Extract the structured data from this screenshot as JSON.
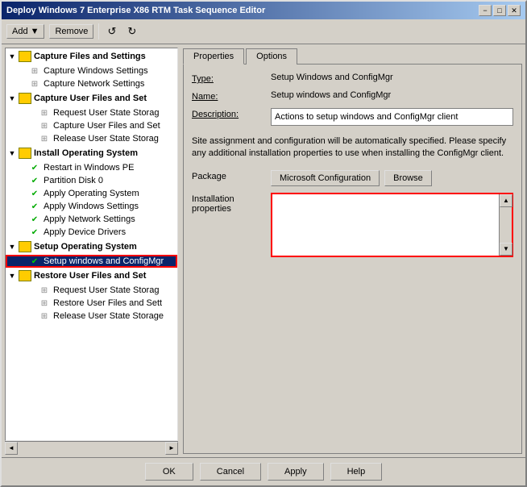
{
  "window": {
    "title": "Deploy Windows 7 Enterprise X86 RTM Task Sequence Editor",
    "min_btn": "−",
    "max_btn": "□",
    "close_btn": "✕"
  },
  "toolbar": {
    "add_label": "Add",
    "remove_label": "Remove",
    "icon1": "↺",
    "icon2": "↻"
  },
  "tree": {
    "groups": [
      {
        "label": "Capture Files and Settings",
        "items": [
          {
            "label": "Capture Windows Settings",
            "icon": "gray"
          },
          {
            "label": "Capture Network Settings",
            "icon": "gray"
          },
          {
            "label": "Capture User Files and Set",
            "icon": "gray",
            "indent": 2
          },
          {
            "label": "Request User State Storag",
            "icon": "gray",
            "indent": 3
          },
          {
            "label": "Capture User Files and Set",
            "icon": "gray",
            "indent": 3
          },
          {
            "label": "Release User State Storag",
            "icon": "gray",
            "indent": 3
          }
        ]
      },
      {
        "label": "Install Operating System",
        "items": [
          {
            "label": "Restart in Windows PE",
            "icon": "green"
          },
          {
            "label": "Partition Disk 0",
            "icon": "green"
          },
          {
            "label": "Apply Operating System",
            "icon": "green"
          },
          {
            "label": "Apply Windows Settings",
            "icon": "green"
          },
          {
            "label": "Apply Network Settings",
            "icon": "green"
          },
          {
            "label": "Apply Device Drivers",
            "icon": "green"
          }
        ]
      },
      {
        "label": "Setup Operating System",
        "items": [
          {
            "label": "Setup windows and ConfigMgr",
            "icon": "green",
            "selected": true
          },
          {
            "label": "Restore User Files and Set",
            "icon": "gray",
            "indent": 2
          },
          {
            "label": "Request User State Storag",
            "icon": "gray",
            "indent": 3
          },
          {
            "label": "Restore User Files and Sett",
            "icon": "gray",
            "indent": 3
          },
          {
            "label": "Release User State Storage",
            "icon": "gray",
            "indent": 3
          }
        ]
      }
    ]
  },
  "tabs": {
    "properties_label": "Properties",
    "options_label": "Options"
  },
  "properties": {
    "type_label": "Type:",
    "type_value": "Setup Windows and ConfigMgr",
    "name_label": "Name:",
    "name_value": "Setup windows and ConfigMgr",
    "description_label": "Description:",
    "description_value": "Actions to setup windows and ConfigMgr client",
    "info_text": "Site assignment and configuration will be automatically specified. Please specify any additional installation properties to use when installing the ConfigMgr client.",
    "package_label": "Package",
    "package_btn": "Microsoft Configuration",
    "browse_btn": "Browse",
    "install_props_label": "Installation properties"
  },
  "bottom": {
    "ok_label": "OK",
    "cancel_label": "Cancel",
    "apply_label": "Apply",
    "help_label": "Help"
  }
}
